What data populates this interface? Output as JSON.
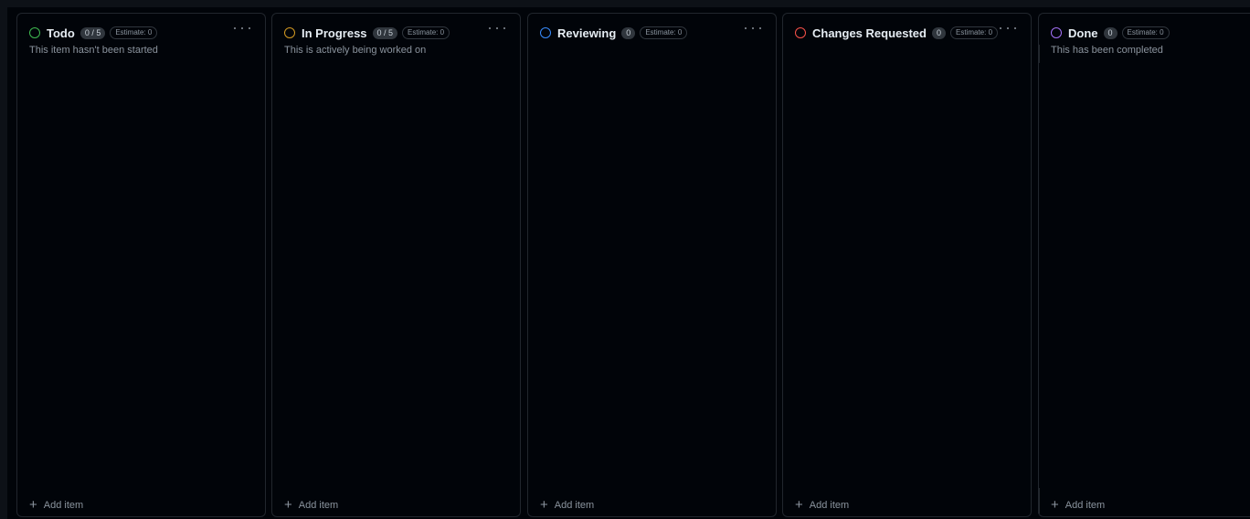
{
  "board": {
    "columns": [
      {
        "title": "Todo",
        "count": "0 / 5",
        "estimate": "Estimate: 0",
        "description": "This item hasn't been started",
        "status_color": "#3fb950",
        "add_label": "Add item",
        "status_icon": "circle-icon"
      },
      {
        "title": "In Progress",
        "count": "0 / 5",
        "estimate": "Estimate: 0",
        "description": "This is actively being worked on",
        "status_color": "#d29922",
        "add_label": "Add item",
        "status_icon": "circle-icon"
      },
      {
        "title": "Reviewing",
        "count": "0",
        "estimate": "Estimate: 0",
        "description": "",
        "status_color": "#388bfd",
        "add_label": "Add item",
        "status_icon": "circle-icon"
      },
      {
        "title": "Changes Requested",
        "count": "0",
        "estimate": "Estimate: 0",
        "description": "",
        "status_color": "#f85149",
        "add_label": "Add item",
        "status_icon": "circle-icon"
      },
      {
        "title": "Done",
        "count": "0",
        "estimate": "Estimate: 0",
        "description": "This has been completed",
        "status_color": "#a371f7",
        "add_label": "Add item",
        "status_icon": "circle-icon"
      }
    ],
    "more_icon": "ellipsis-icon",
    "add_icon": "plus-icon",
    "background_color": "#0d1117",
    "column_color": "#010409"
  }
}
